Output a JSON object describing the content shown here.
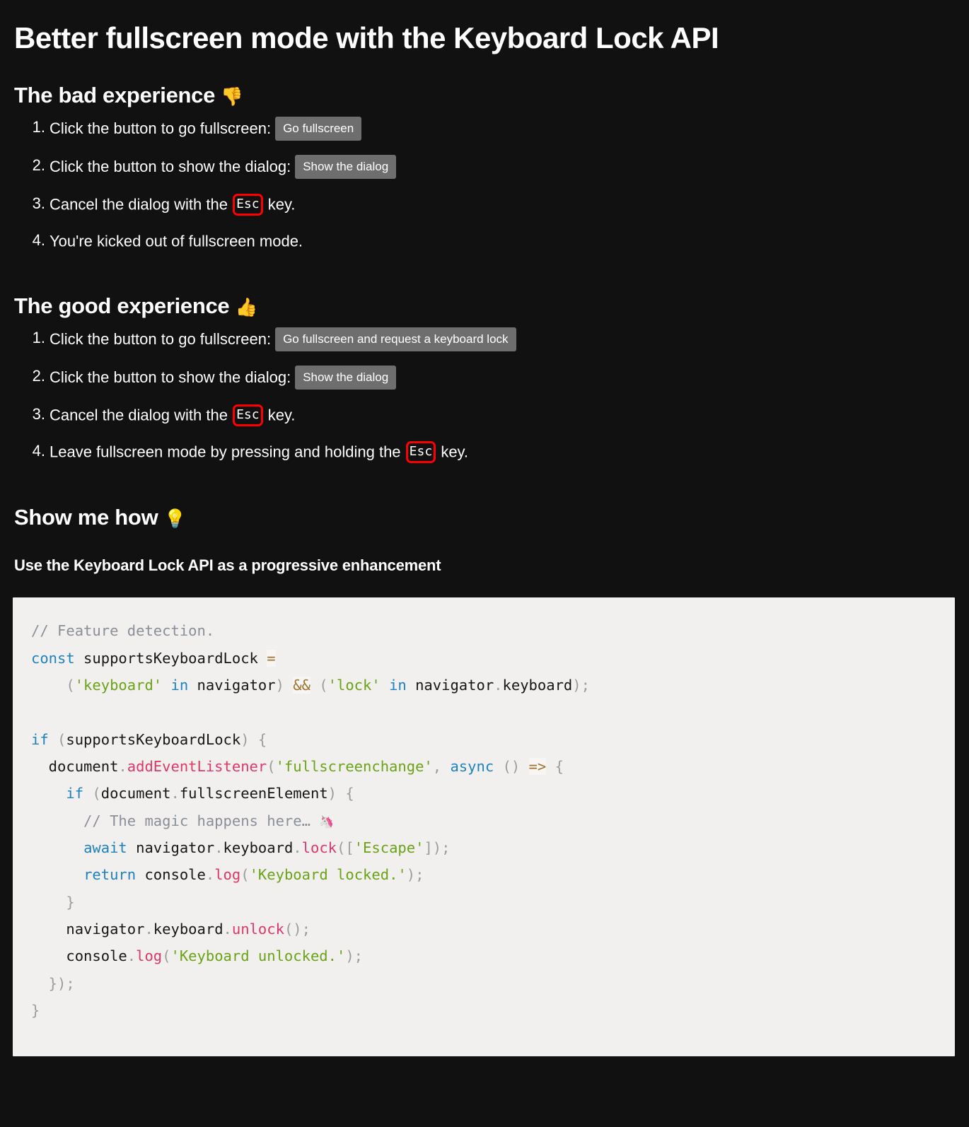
{
  "document": {
    "title": "Better fullscreen mode with the Keyboard Lock API",
    "background_color": "#111111",
    "text_color": "#ffffff"
  },
  "sections": {
    "bad": {
      "heading": "The bad experience",
      "heading_emoji": "👎",
      "heading_emoji_name": "thumbs-down-emoji",
      "steps": [
        {
          "number": "1.",
          "text": "Click the button to go fullscreen:",
          "button": "Go fullscreen"
        },
        {
          "number": "2.",
          "text": "Click the button to show the dialog:",
          "button": "Show the dialog"
        },
        {
          "number": "3.",
          "text_before": "Cancel the dialog with the",
          "key": "Esc",
          "text_after": "key."
        },
        {
          "number": "4.",
          "text": "You're kicked out of fullscreen mode."
        }
      ]
    },
    "good": {
      "heading": "The good experience",
      "heading_emoji": "👍",
      "heading_emoji_name": "thumbs-up-emoji",
      "steps": [
        {
          "number": "1.",
          "text": "Click the button to go fullscreen:",
          "button": "Go fullscreen and request a keyboard lock"
        },
        {
          "number": "2.",
          "text": "Click the button to show the dialog:",
          "button": "Show the dialog"
        },
        {
          "number": "3.",
          "text_before": "Cancel the dialog with the",
          "key": "Esc",
          "text_after": "key."
        },
        {
          "number": "4.",
          "text_before": "Leave fullscreen mode by pressing and holding the",
          "key": "Esc",
          "text_after": "key."
        }
      ]
    },
    "how": {
      "heading": "Show me how",
      "heading_emoji": "💡",
      "heading_emoji_name": "light-bulb-emoji",
      "subheading": "Use the Keyboard Lock API as a progressive enhancement"
    }
  },
  "code_block": {
    "language": "javascript",
    "background_color": "#f1f0ee",
    "plain_text": "// Feature detection.\nconst supportsKeyboardLock =\n    ('keyboard' in navigator) && ('lock' in navigator.keyboard);\n\nif (supportsKeyboardLock) {\n  document.addEventListener('fullscreenchange', async () => {\n    if (document.fullscreenElement) {\n      // The magic happens here… 🦄\n      await navigator.keyboard.lock(['Escape']);\n      return console.log('Keyboard locked.');\n    }\n    navigator.keyboard.unlock();\n    console.log('Keyboard unlocked.');\n  });\n}",
    "syntax_colors": {
      "comment": "#8a8f98",
      "keyword": "#1c82c4",
      "string": "#6aa316",
      "operator": "#a0722c",
      "punctuation": "#9c9c9c",
      "method": "#e0376b",
      "plain": "#161616"
    },
    "lines": [
      [
        {
          "t": "// Feature detection.",
          "c": "comment"
        }
      ],
      [
        {
          "t": "const",
          "c": "keyword"
        },
        {
          "t": " supportsKeyboardLock ",
          "c": "plain"
        },
        {
          "t": "=",
          "c": "operator"
        }
      ],
      [
        {
          "t": "    (",
          "c": "punct"
        },
        {
          "t": "'keyboard'",
          "c": "string"
        },
        {
          "t": " ",
          "c": "plain"
        },
        {
          "t": "in",
          "c": "keyword"
        },
        {
          "t": " navigator",
          "c": "plain"
        },
        {
          "t": ")",
          "c": "punct"
        },
        {
          "t": " ",
          "c": "plain"
        },
        {
          "t": "&&",
          "c": "operator"
        },
        {
          "t": " (",
          "c": "punct"
        },
        {
          "t": "'lock'",
          "c": "string"
        },
        {
          "t": " ",
          "c": "plain"
        },
        {
          "t": "in",
          "c": "keyword"
        },
        {
          "t": " navigator",
          "c": "plain"
        },
        {
          "t": ".",
          "c": "dot"
        },
        {
          "t": "keyboard",
          "c": "plain"
        },
        {
          "t": ");",
          "c": "punct"
        }
      ],
      [
        {
          "t": "",
          "c": "plain"
        }
      ],
      [
        {
          "t": "if",
          "c": "keyword"
        },
        {
          "t": " (",
          "c": "punct"
        },
        {
          "t": "supportsKeyboardLock",
          "c": "plain"
        },
        {
          "t": ") {",
          "c": "punct"
        }
      ],
      [
        {
          "t": "  document",
          "c": "plain"
        },
        {
          "t": ".",
          "c": "dot"
        },
        {
          "t": "addEventListener",
          "c": "method"
        },
        {
          "t": "(",
          "c": "punct"
        },
        {
          "t": "'fullscreenchange'",
          "c": "string"
        },
        {
          "t": ", ",
          "c": "punct"
        },
        {
          "t": "async",
          "c": "keyword"
        },
        {
          "t": " ()",
          "c": "punct"
        },
        {
          "t": " ",
          "c": "plain"
        },
        {
          "t": "=>",
          "c": "operator"
        },
        {
          "t": " {",
          "c": "punct"
        }
      ],
      [
        {
          "t": "    ",
          "c": "plain"
        },
        {
          "t": "if",
          "c": "keyword"
        },
        {
          "t": " (",
          "c": "punct"
        },
        {
          "t": "document",
          "c": "plain"
        },
        {
          "t": ".",
          "c": "dot"
        },
        {
          "t": "fullscreenElement",
          "c": "plain"
        },
        {
          "t": ") {",
          "c": "punct"
        }
      ],
      [
        {
          "t": "      // The magic happens here… ",
          "c": "comment"
        },
        {
          "t": "🦄",
          "c": "emoji"
        }
      ],
      [
        {
          "t": "      ",
          "c": "plain"
        },
        {
          "t": "await",
          "c": "keyword"
        },
        {
          "t": " navigator",
          "c": "plain"
        },
        {
          "t": ".",
          "c": "dot"
        },
        {
          "t": "keyboard",
          "c": "plain"
        },
        {
          "t": ".",
          "c": "dot"
        },
        {
          "t": "lock",
          "c": "method"
        },
        {
          "t": "([",
          "c": "punct"
        },
        {
          "t": "'Escape'",
          "c": "string"
        },
        {
          "t": "]);",
          "c": "punct"
        }
      ],
      [
        {
          "t": "      ",
          "c": "plain"
        },
        {
          "t": "return",
          "c": "keyword"
        },
        {
          "t": " console",
          "c": "plain"
        },
        {
          "t": ".",
          "c": "dot"
        },
        {
          "t": "log",
          "c": "method"
        },
        {
          "t": "(",
          "c": "punct"
        },
        {
          "t": "'Keyboard locked.'",
          "c": "string"
        },
        {
          "t": ");",
          "c": "punct"
        }
      ],
      [
        {
          "t": "    }",
          "c": "punct"
        }
      ],
      [
        {
          "t": "    navigator",
          "c": "plain"
        },
        {
          "t": ".",
          "c": "dot"
        },
        {
          "t": "keyboard",
          "c": "plain"
        },
        {
          "t": ".",
          "c": "dot"
        },
        {
          "t": "unlock",
          "c": "method"
        },
        {
          "t": "();",
          "c": "punct"
        }
      ],
      [
        {
          "t": "    console",
          "c": "plain"
        },
        {
          "t": ".",
          "c": "dot"
        },
        {
          "t": "log",
          "c": "method"
        },
        {
          "t": "(",
          "c": "punct"
        },
        {
          "t": "'Keyboard unlocked.'",
          "c": "string"
        },
        {
          "t": ");",
          "c": "punct"
        }
      ],
      [
        {
          "t": "  });",
          "c": "punct"
        }
      ],
      [
        {
          "t": "}",
          "c": "punct"
        }
      ]
    ]
  }
}
